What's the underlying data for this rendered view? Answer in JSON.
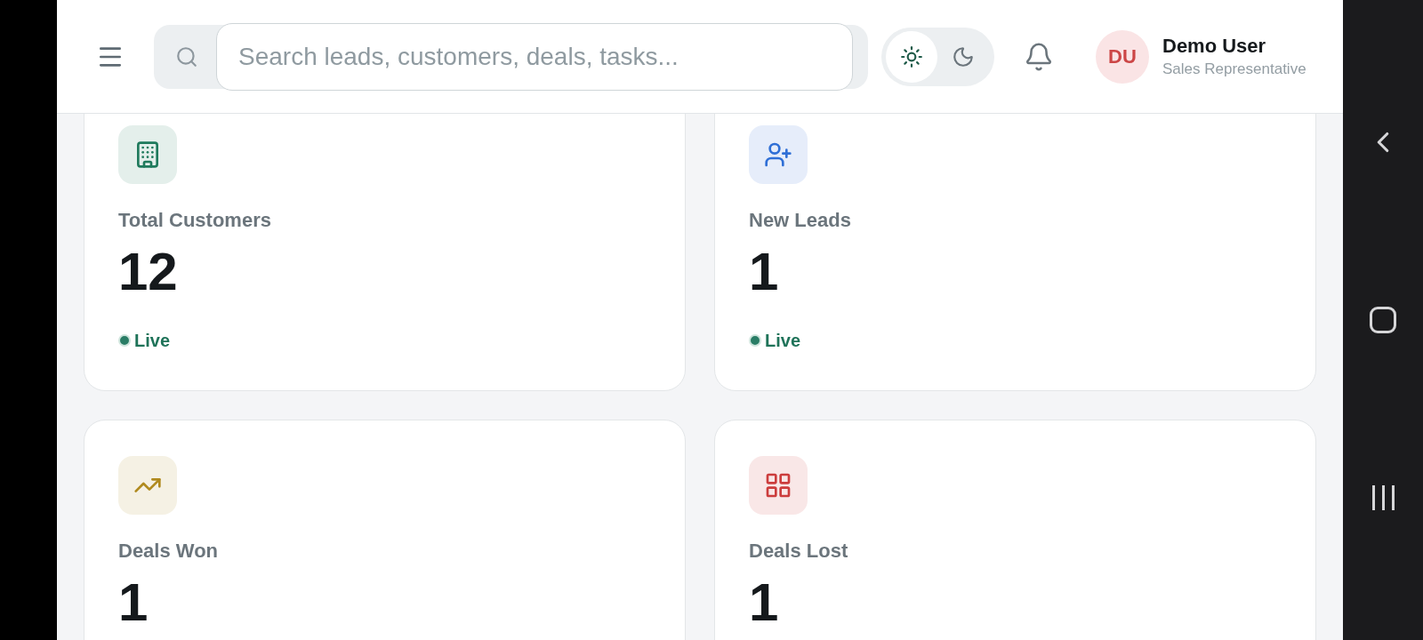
{
  "header": {
    "search": {
      "placeholder": "Search leads, customers, deals, tasks..."
    },
    "theme_toggle": [
      {
        "kind": "light",
        "selected": true
      },
      {
        "kind": "dark",
        "selected": false
      }
    ],
    "user": {
      "initials": "DU",
      "name": "Demo User",
      "role": "Sales Representative"
    }
  },
  "cards": [
    {
      "kind": "building",
      "title": "Total Customers",
      "value": "12",
      "status": "Live",
      "color": "#1f7a5c"
    },
    {
      "kind": "user-plus",
      "title": "New Leads",
      "value": "1",
      "status": "Live",
      "color": "#2f6fd6"
    },
    {
      "kind": "trend",
      "title": "Deals Won",
      "value": "1",
      "color": "#b08a1e"
    },
    {
      "kind": "grid",
      "title": "Deals Lost",
      "value": "1",
      "color": "#cc3d3d"
    }
  ]
}
